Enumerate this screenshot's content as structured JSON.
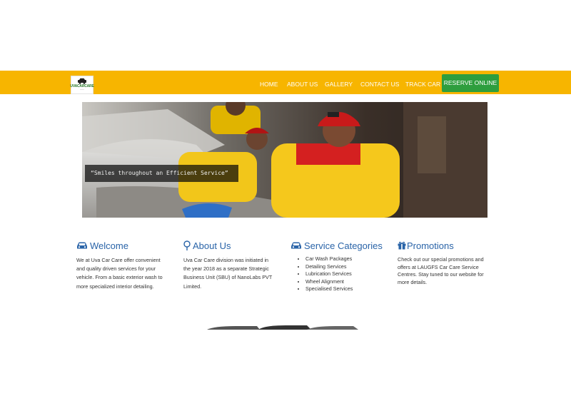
{
  "header": {
    "logo_text": "UVACARCARE",
    "nav": [
      "HOME",
      "ABOUT US",
      "GALLERY",
      "CONTACT US",
      "TRACK CAR"
    ],
    "reserve_label": "RESERVE ONLINE"
  },
  "hero": {
    "tagline": "“Smiles throughout an Efficient Service”"
  },
  "sections": {
    "welcome": {
      "title": "Welcome",
      "icon": "car-icon",
      "lines": [
        "We at Uva Car Care offer convenient",
        "and quality driven services for your",
        "vehicle. From a basic exterior wash to",
        "more specialized interior detailing."
      ]
    },
    "about": {
      "title": "About Us",
      "icon": "map-pin-icon",
      "lines": [
        "Uva Car Care division was initiated in",
        "the year 2018 as a separate Strategic",
        "Business Unit (SBU) of NanoLabs PVT",
        "Limited."
      ]
    },
    "services": {
      "title": "Service Categories",
      "icon": "car-icon",
      "items": [
        "Car Wash Packages",
        "Detailing Services",
        "Lubrication Services",
        "Wheel Alignment",
        "Specialised Services"
      ]
    },
    "promotions": {
      "title": "Promotions",
      "icon": "gift-icon",
      "lines": [
        "Check out our special promotions and",
        "offers at LAUGFS Car Care Service",
        "Centres. Stay tuned to our website for",
        "more details."
      ]
    }
  },
  "colors": {
    "navbar": "#f7b500",
    "reserve_button": "#2e9e3e",
    "heading": "#2a64a8"
  }
}
